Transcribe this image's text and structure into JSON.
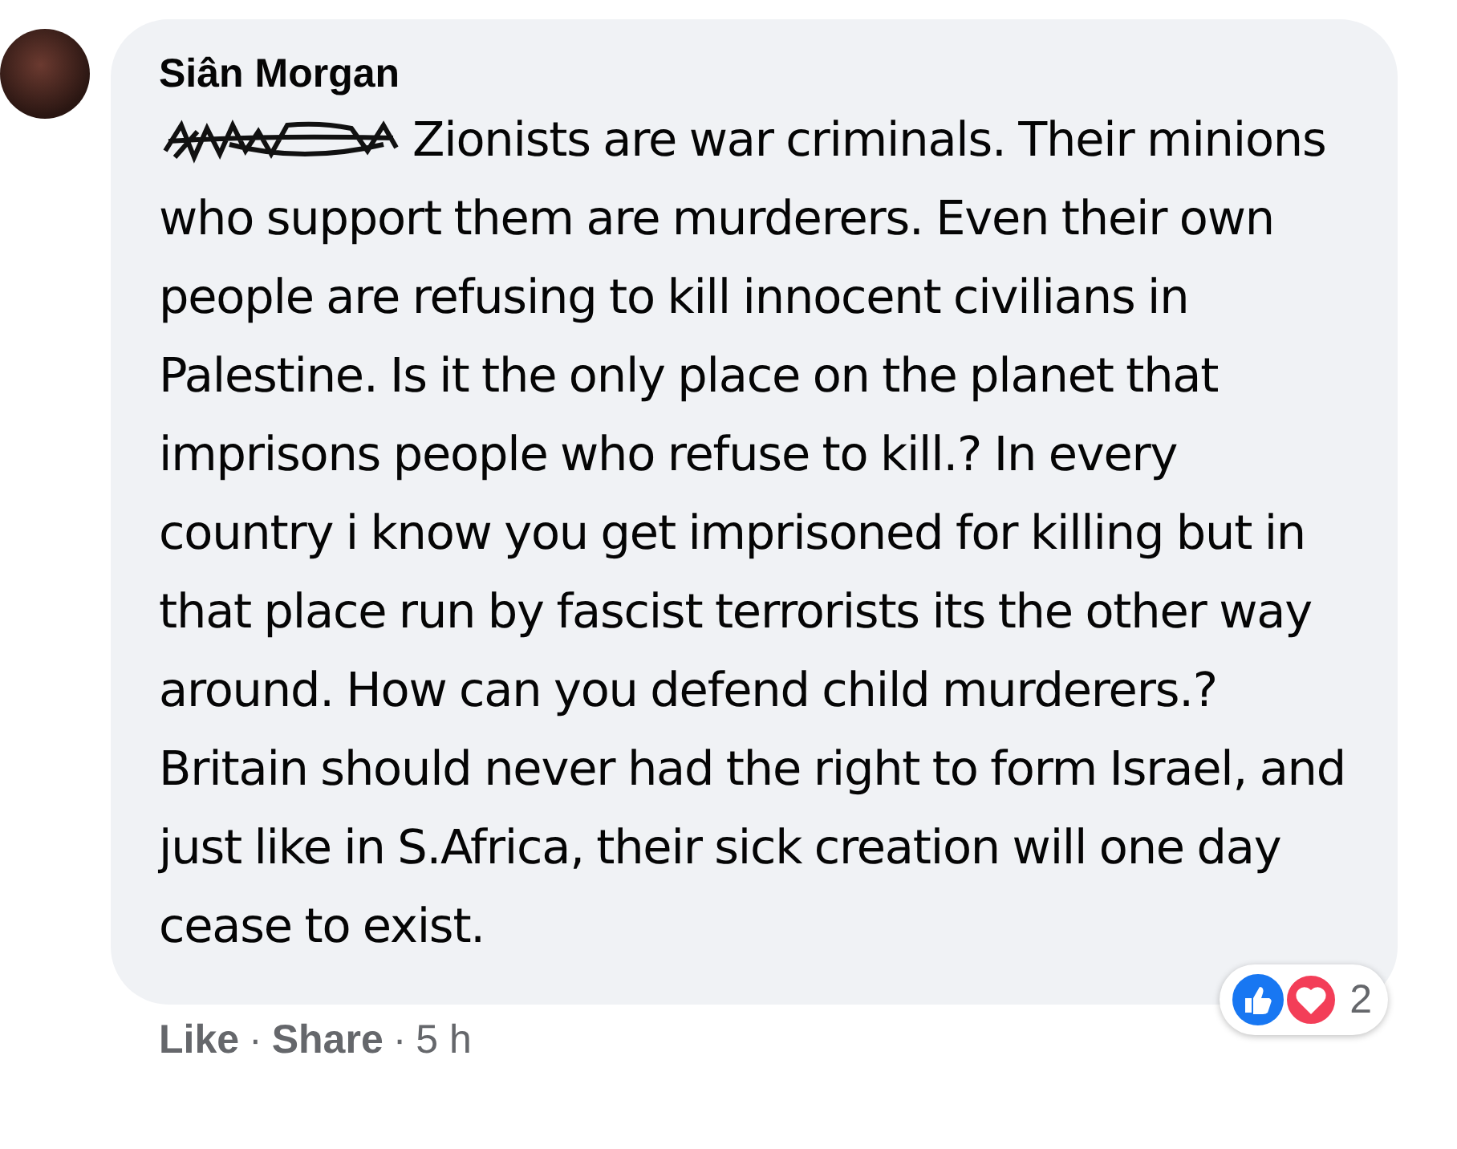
{
  "comment": {
    "author": "Siân Morgan",
    "text": "Zionists are war criminals. Their minions who support them are murderers. Even their own people are refusing to kill innocent civilians in Palestine. Is it the only place on the planet that imprisons people who refuse to kill.? In every country i know you get imprisoned for killing but in that place run by fascist terrorists its the other way around. How can you defend child murderers.? Britain should never had the right to form Israel, and just like in S.Africa, their sick creation will one day cease to exist.",
    "reaction_count": "2"
  },
  "actions": [
    {
      "kind": "link",
      "label": "Like"
    },
    {
      "kind": "separator",
      "label": "·"
    },
    {
      "kind": "link",
      "label": "Share"
    },
    {
      "kind": "separator",
      "label": "·"
    },
    {
      "kind": "time",
      "label": "5 h"
    }
  ]
}
